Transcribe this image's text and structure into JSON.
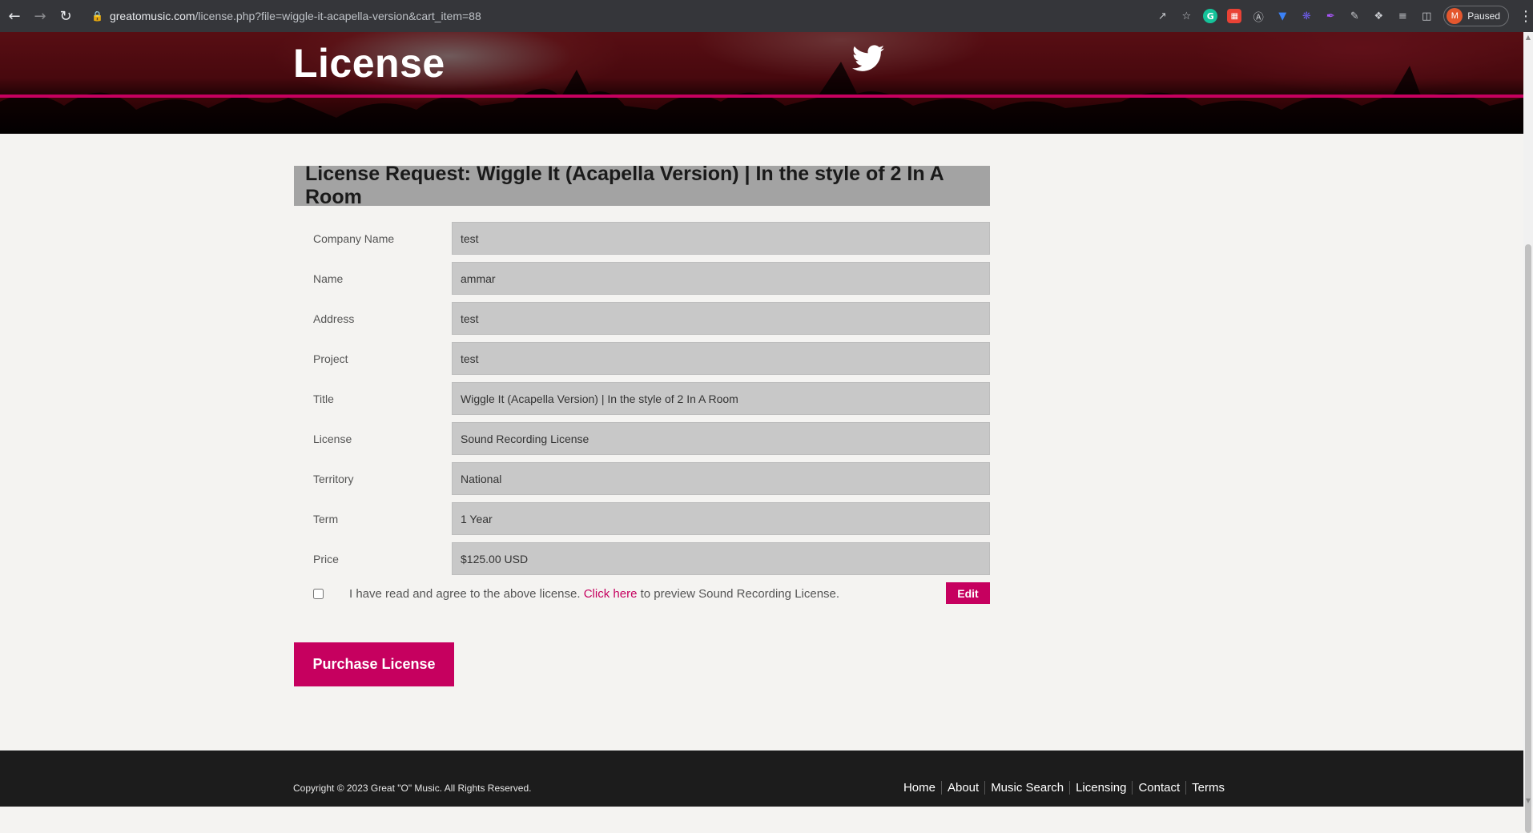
{
  "browser": {
    "url_host": "greatomusic.com",
    "url_path": "/license.php?file=wiggle-it-acapella-version&cart_item=88",
    "profile_status": "Paused",
    "profile_initial": "M"
  },
  "hero": {
    "title": "License"
  },
  "license_request": {
    "header": "License Request: Wiggle It (Acapella Version) | In the style of 2 In A Room",
    "fields": [
      {
        "label": "Company Name",
        "value": "test"
      },
      {
        "label": "Name",
        "value": "ammar"
      },
      {
        "label": "Address",
        "value": "test"
      },
      {
        "label": "Project",
        "value": "test"
      },
      {
        "label": "Title",
        "value": "Wiggle It (Acapella Version) | In the style of 2 In A Room"
      },
      {
        "label": "License",
        "value": "Sound Recording License"
      },
      {
        "label": "Territory",
        "value": "National"
      },
      {
        "label": "Term",
        "value": "1 Year"
      },
      {
        "label": "Price",
        "value": "$125.00 USD"
      }
    ],
    "agree_text_before": "I have read and agree to the above license.",
    "agree_link": "Click here",
    "agree_text_after": "to preview Sound Recording License.",
    "edit_label": "Edit",
    "purchase_label": "Purchase License"
  },
  "footer": {
    "copyright": "Copyright © 2023 Great \"O\" Music. All Rights Reserved.",
    "nav": [
      "Home",
      "About",
      "Music Search",
      "Licensing",
      "Contact",
      "Terms"
    ]
  },
  "colors": {
    "accent": "#c6005f",
    "field_bg": "#c8c8c8",
    "header_bg": "#a3a3a3",
    "footer_bg": "#1c1c1c"
  }
}
